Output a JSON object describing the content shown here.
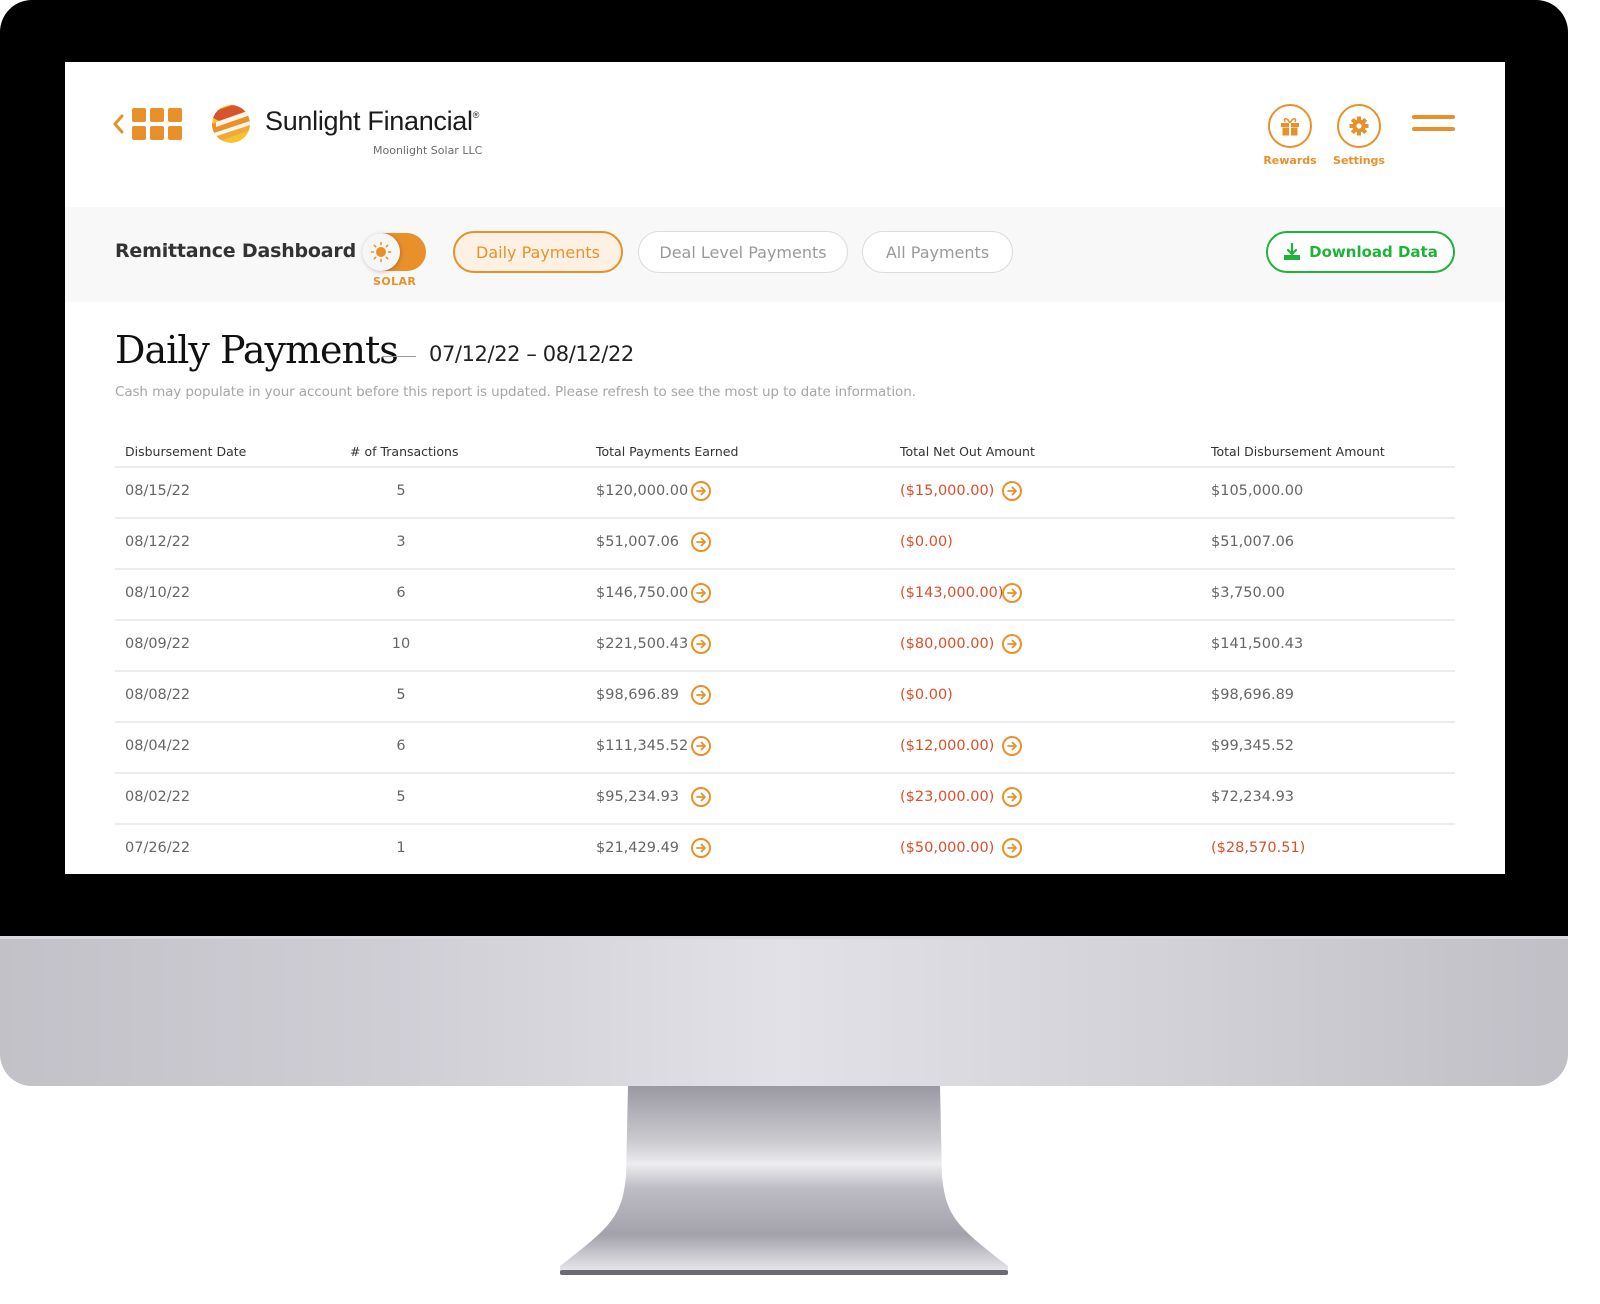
{
  "header": {
    "brand_name": "Sunlight Financial",
    "brand_mark": "®",
    "company": "Moonlight Solar LLC",
    "actions": [
      {
        "label": "Rewards",
        "icon": "gift-icon"
      },
      {
        "label": "Settings",
        "icon": "gear-icon"
      }
    ],
    "menu_icon": "hamburger-icon",
    "back_icon": "chevron-left-icon",
    "apps_icon": "app-grid-icon"
  },
  "toolbar": {
    "title": "Remittance Dashboard",
    "toggle": {
      "label": "SOLAR",
      "icon": "sun-icon",
      "on": true
    },
    "tabs": [
      {
        "label": "Daily Payments",
        "active": true
      },
      {
        "label": "Deal Level Payments",
        "active": false
      },
      {
        "label": "All Payments",
        "active": false
      }
    ],
    "download_label": "Download Data",
    "download_icon": "download-icon"
  },
  "main": {
    "title": "Daily Payments",
    "date_range": "07/12/22 – 08/12/22",
    "notice": "Cash may populate in your account before this report is updated. Please refresh to see the most up to date information."
  },
  "table": {
    "columns": [
      "Disbursement Date",
      "# of Transactions",
      "Total Payments Earned",
      "Total Net Out Amount",
      "Total Disbursement Amount"
    ],
    "rows": [
      {
        "date": "08/15/22",
        "count": "5",
        "earned": "$120,000.00",
        "earned_link": true,
        "net": "($15,000.00)",
        "net_link": true,
        "disb": "$105,000.00",
        "disb_negative": false
      },
      {
        "date": "08/12/22",
        "count": "3",
        "earned": "$51,007.06",
        "earned_link": true,
        "net": "($0.00)",
        "net_link": false,
        "disb": "$51,007.06",
        "disb_negative": false
      },
      {
        "date": "08/10/22",
        "count": "6",
        "earned": "$146,750.00",
        "earned_link": true,
        "net": "($143,000.00)",
        "net_link": true,
        "disb": "$3,750.00",
        "disb_negative": false
      },
      {
        "date": "08/09/22",
        "count": "10",
        "earned": "$221,500.43",
        "earned_link": true,
        "net": "($80,000.00)",
        "net_link": true,
        "disb": "$141,500.43",
        "disb_negative": false
      },
      {
        "date": "08/08/22",
        "count": "5",
        "earned": "$98,696.89",
        "earned_link": true,
        "net": "($0.00)",
        "net_link": false,
        "disb": "$98,696.89",
        "disb_negative": false
      },
      {
        "date": "08/04/22",
        "count": "6",
        "earned": "$111,345.52",
        "earned_link": true,
        "net": "($12,000.00)",
        "net_link": true,
        "disb": "$99,345.52",
        "disb_negative": false
      },
      {
        "date": "08/02/22",
        "count": "5",
        "earned": "$95,234.93",
        "earned_link": true,
        "net": "($23,000.00)",
        "net_link": true,
        "disb": "$72,234.93",
        "disb_negative": false
      },
      {
        "date": "07/26/22",
        "count": "1",
        "earned": "$21,429.49",
        "earned_link": true,
        "net": "($50,000.00)",
        "net_link": true,
        "disb": "($28,570.51)",
        "disb_negative": true
      }
    ]
  },
  "colors": {
    "accent": "#e8912b",
    "negative": "#d9502a",
    "success": "#1fb33a",
    "text": "#666666"
  }
}
